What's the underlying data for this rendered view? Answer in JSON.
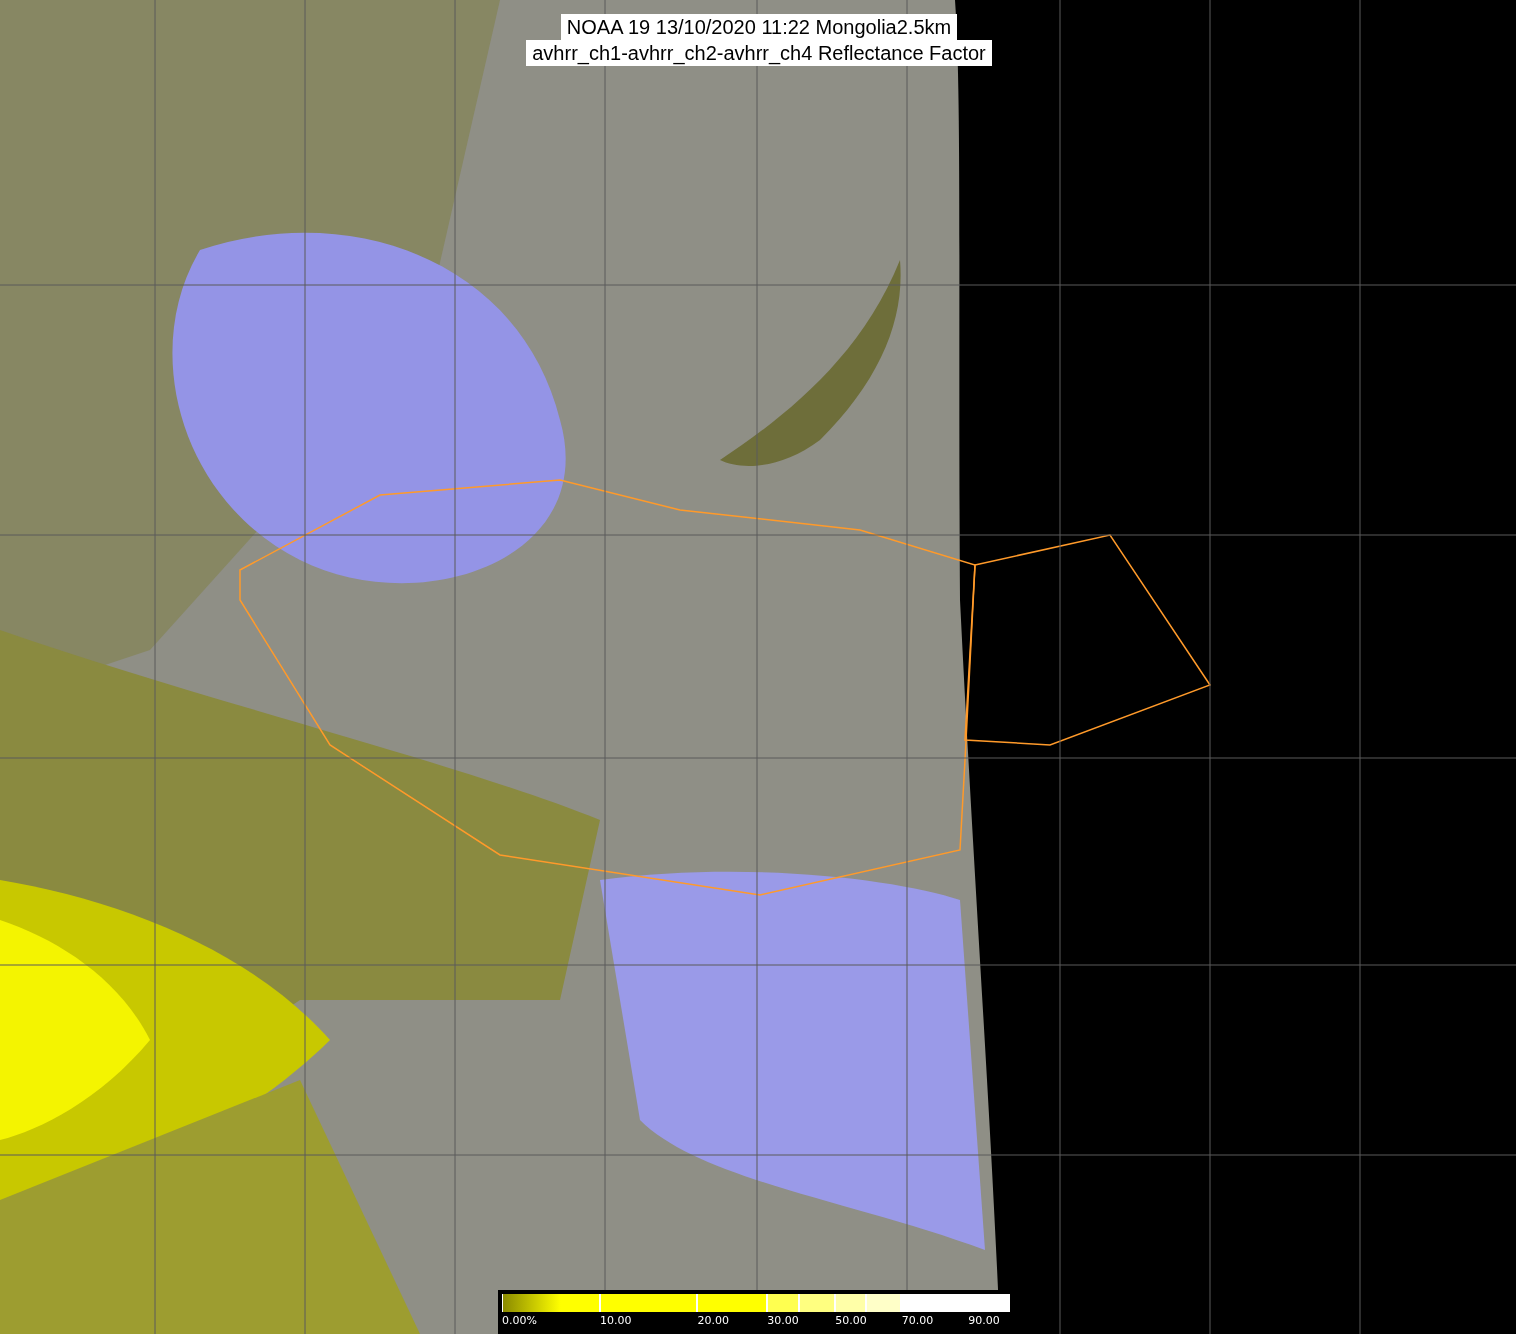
{
  "title": {
    "lines": [
      "NOAA 19 13/10/2020 11:22 Mongolia2.5km",
      "avhrr_ch1-avhrr_ch2-avhrr_ch4 Reflectance Factor"
    ]
  },
  "legend": {
    "segments": [
      {
        "color": "#ffff00"
      },
      {
        "color": "#ffff00"
      },
      {
        "color": "#ffff00"
      },
      {
        "color": "#ffff50"
      },
      {
        "color": "#ffff80"
      },
      {
        "color": "#ffffa8"
      },
      {
        "color": "#ffffc8"
      },
      {
        "color": "#ffffff"
      },
      {
        "color": "#ffffff"
      },
      {
        "color": "#ffffff"
      }
    ],
    "ticks": [
      "0.00%",
      "10.00",
      "20.00",
      "30.00",
      "50.00",
      "70.00",
      "90.00"
    ]
  }
}
